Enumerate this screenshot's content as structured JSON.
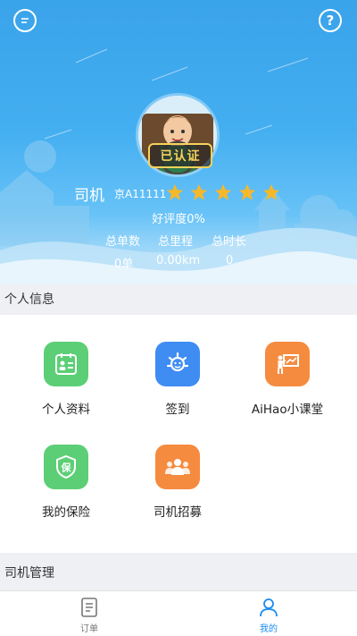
{
  "header": {
    "message_icon": "chat-bubble-icon",
    "help_icon": "question-circle-icon",
    "badge": "已认证",
    "driver_name": "司机",
    "plate": "京A11111",
    "stars": 5,
    "rating_text": "好评度0%",
    "stats": [
      {
        "label": "总单数",
        "value": "0单"
      },
      {
        "label": "总里程",
        "value": "0.00km"
      },
      {
        "label": "总时长",
        "value": "0"
      }
    ]
  },
  "sections": {
    "personal": "个人信息",
    "driver_manage": "司机管理"
  },
  "features": [
    {
      "label": "个人资料",
      "icon": "profile-card-icon",
      "color": "#5ccf76"
    },
    {
      "label": "签到",
      "icon": "sign-in-icon",
      "color": "#3f8cf2"
    },
    {
      "label": "AiHao小课堂",
      "icon": "classroom-icon",
      "color": "#f58b3f"
    },
    {
      "label": "我的保险",
      "icon": "insurance-shield-icon",
      "color": "#5ccf76"
    },
    {
      "label": "司机招募",
      "icon": "recruit-people-icon",
      "color": "#f58b3f"
    }
  ],
  "tabs": [
    {
      "label": "订单",
      "icon": "order-list-icon",
      "active": false
    },
    {
      "label": "我的",
      "icon": "user-icon",
      "active": true
    }
  ],
  "colors": {
    "accent": "#1a8cf0",
    "star": "#f5b82a",
    "inactive_tab": "#777777"
  }
}
